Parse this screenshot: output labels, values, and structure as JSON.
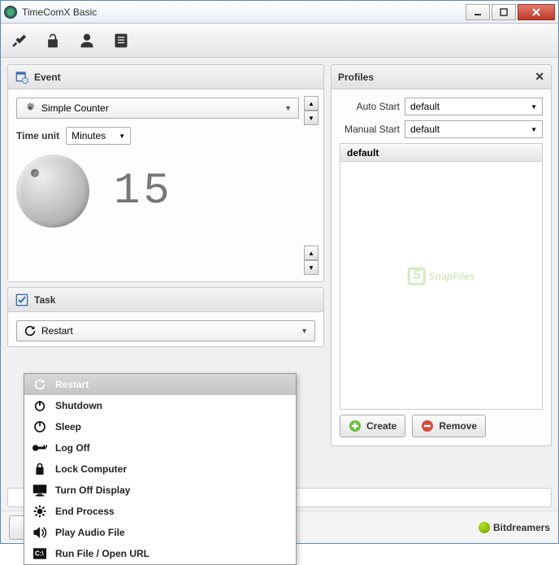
{
  "window": {
    "title": "TimeComX Basic"
  },
  "event": {
    "header": "Event",
    "counter_label": "Simple Counter",
    "time_unit_label": "Time unit",
    "time_unit_value": "Minutes",
    "display_value": "15"
  },
  "task": {
    "header": "Task",
    "selected": "Restart",
    "options": [
      {
        "icon": "restart-icon",
        "label": "Restart"
      },
      {
        "icon": "shutdown-icon",
        "label": "Shutdown"
      },
      {
        "icon": "sleep-icon",
        "label": "Sleep"
      },
      {
        "icon": "logoff-icon",
        "label": "Log Off"
      },
      {
        "icon": "lock-icon",
        "label": "Lock Computer"
      },
      {
        "icon": "display-icon",
        "label": "Turn Off Display"
      },
      {
        "icon": "process-icon",
        "label": "End Process"
      },
      {
        "icon": "audio-icon",
        "label": "Play Audio File"
      },
      {
        "icon": "run-icon",
        "label": "Run File / Open URL"
      }
    ]
  },
  "profiles": {
    "header": "Profiles",
    "auto_start_label": "Auto Start",
    "auto_start_value": "default",
    "manual_start_label": "Manual Start",
    "manual_start_value": "default",
    "list_header": "default",
    "create_label": "Create",
    "remove_label": "Remove",
    "watermark": "SnapFiles"
  },
  "brand": {
    "name": "Bitdreamers"
  }
}
